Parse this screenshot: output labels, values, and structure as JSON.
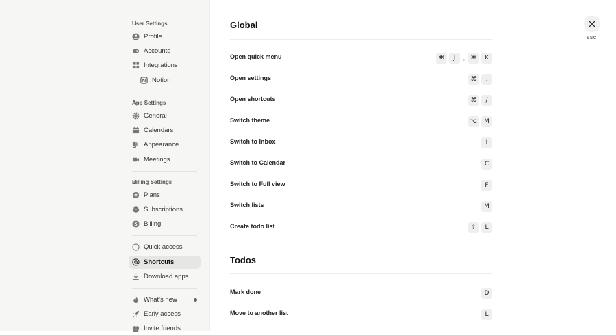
{
  "sidebar": {
    "user_settings": {
      "title": "User Settings",
      "items": [
        {
          "label": "Profile"
        },
        {
          "label": "Accounts"
        },
        {
          "label": "Integrations"
        },
        {
          "label": "Notion"
        }
      ]
    },
    "app_settings": {
      "title": "App Settings",
      "items": [
        {
          "label": "General"
        },
        {
          "label": "Calendars"
        },
        {
          "label": "Appearance"
        },
        {
          "label": "Meetings"
        }
      ]
    },
    "billing_settings": {
      "title": "Billing Settings",
      "items": [
        {
          "label": "Plans"
        },
        {
          "label": "Subscriptions"
        },
        {
          "label": "Billing"
        }
      ]
    },
    "misc": [
      {
        "label": "Quick access"
      },
      {
        "label": "Shortcuts",
        "active": true
      },
      {
        "label": "Download apps"
      }
    ],
    "extra": [
      {
        "label": "What's new"
      },
      {
        "label": "Early access"
      },
      {
        "label": "Invite friends"
      }
    ]
  },
  "close": {
    "label": "ESC"
  },
  "global": {
    "title": "Global",
    "shortcuts": [
      {
        "label": "Open quick menu",
        "keys": [
          "⌘",
          "J"
        ],
        "keys2": [
          "⌘",
          "K"
        ],
        "separator": ","
      },
      {
        "label": "Open settings",
        "keys": [
          "⌘",
          ","
        ]
      },
      {
        "label": "Open shortcuts",
        "keys": [
          "⌘",
          "/"
        ]
      },
      {
        "label": "Switch theme",
        "keys": [
          "⌥",
          "M"
        ]
      },
      {
        "label": "Switch to Inbox",
        "keys": [
          "I"
        ]
      },
      {
        "label": "Switch to Calendar",
        "keys": [
          "C"
        ]
      },
      {
        "label": "Switch to Full view",
        "keys": [
          "F"
        ]
      },
      {
        "label": "Switch lists",
        "keys": [
          "M"
        ]
      },
      {
        "label": "Create todo list",
        "keys": [
          "⇧",
          "L"
        ]
      }
    ]
  },
  "todos": {
    "title": "Todos",
    "shortcuts": [
      {
        "label": "Mark done",
        "keys": [
          "D"
        ]
      },
      {
        "label": "Move to another list",
        "keys": [
          "L"
        ]
      }
    ]
  }
}
